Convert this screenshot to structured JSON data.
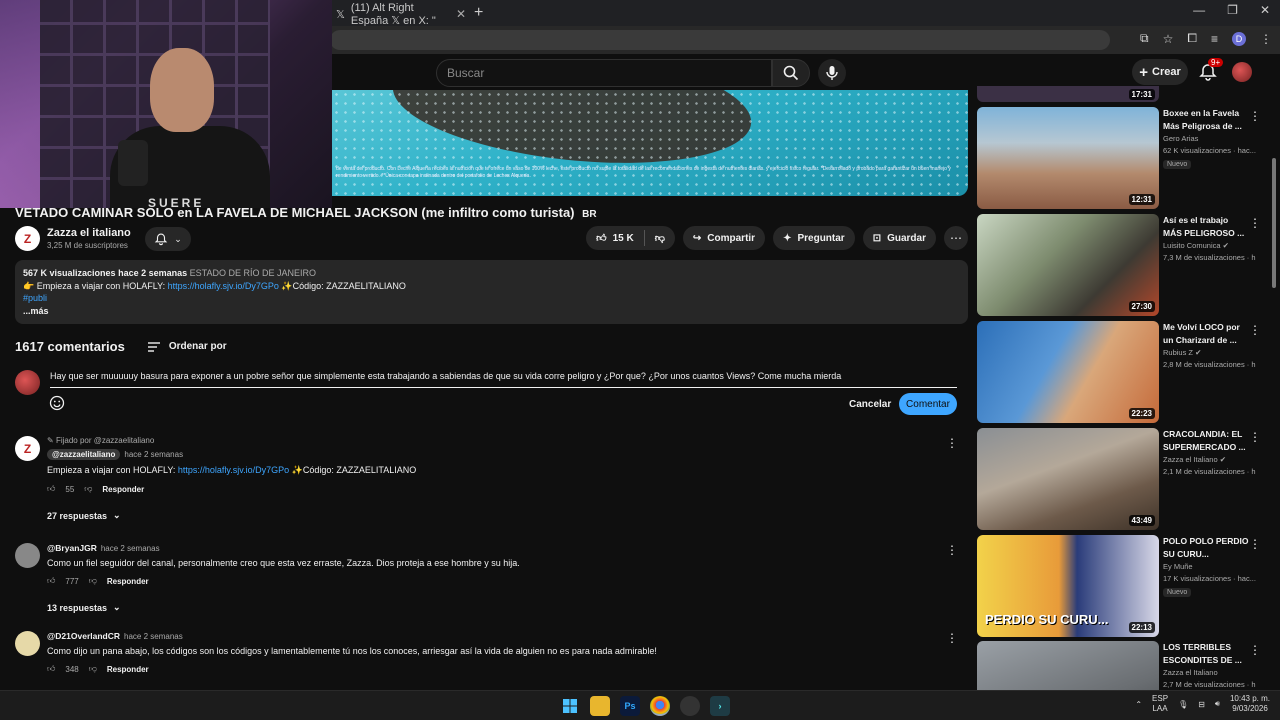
{
  "browser": {
    "tab_title": "(11) Alt Right España 𝕏 en X: \"(...",
    "tab_title_short": "(11) Alt Right España 𝕏 en X: \"",
    "profile_letter": "D"
  },
  "header": {
    "search_placeholder": "Buscar",
    "create_label": "Crear",
    "notifications_badge": "9+"
  },
  "video": {
    "disclaimer": "de venta del producto. Con Leche Alquería recibes la nutrición que te ofrece un vaso de 100% leche, este producto no suple la totalidad de las recomendaciones de ingesta de nutrientes diarias. y ejercicio físico regular. *Desarrollado y probado para garantizar un buen manejo y rendimiento vertido. **Única con tapa inclinada dentro del portafolio de Leches Alquería.",
    "title": "VETADO CAMINAR SOLO en LA FAVELA DE MICHAEL JACKSON (me infiltro como turista)",
    "title_flag": "BR",
    "channel_name": "Zazza el italiano",
    "subscribers": "3,25 M de suscriptores",
    "likes": "15 K",
    "share_label": "Compartir",
    "ask_label": "Preguntar",
    "save_label": "Guardar"
  },
  "description": {
    "views": "567 K visualizaciones",
    "date": "hace 2 semanas",
    "location": "ESTADO DE RÍO DE JANEIRO",
    "line2_prefix": "👉 Empieza a viajar con HOLAFLY:",
    "line2_link": "https://holafly.sjv.io/Dy7GPo",
    "line2_suffix": "✨Código: ZAZZAELITALIANO",
    "hashtag": "#publi",
    "more": "...más"
  },
  "comments": {
    "count_label": "1617 comentarios",
    "sort_label": "Ordenar por",
    "draft_text": "Hay que ser muuuuuy basura para exponer a un pobre señor que simplemente esta trabajando a sabiendas de que su vida corre peligro y ¿Por que? ¿Por unos cuantos Views? Come mucha mierda",
    "cancel_label": "Cancelar",
    "submit_label": "Comentar",
    "items": [
      {
        "pinned": "Fijado por @zazzaelitaliano",
        "author": "@zazzaelitaliano",
        "time": "hace 2 semanas",
        "text_prefix": "Empieza a viajar con HOLAFLY:",
        "text_link": "https://holafly.sjv.io/Dy7GPo",
        "text_suffix": "✨Código: ZAZZAELITALIANO",
        "likes": "55",
        "reply": "Responder",
        "replies": "27 respuestas"
      },
      {
        "author": "@BryanJGR",
        "time": "hace 2 semanas",
        "text": "Como un fiel seguidor del canal, personalmente creo que esta vez erraste, Zazza. Dios proteja a ese hombre y su hija.",
        "likes": "777",
        "reply": "Responder",
        "replies": "13 respuestas"
      },
      {
        "author": "@D21OverlandCR",
        "time": "hace 2 semanas",
        "text": "Como dijo un pana abajo, los códigos son los códigos y lamentablemente tú nos los conoces, arriesgar así la vida de alguien no es para nada admirable!",
        "likes": "348",
        "reply": "Responder"
      }
    ]
  },
  "sidebar": {
    "top_duration": "17:31",
    "items": [
      {
        "title": "Boxee en la Favela Más Peligrosa de ...",
        "channel": "Gero Arias",
        "views": "62 K visualizaciones · hac...",
        "badge": "Nuevo",
        "duration": "12:31"
      },
      {
        "title": "Así es el trabajo MÁS PELIGROSO ...",
        "channel": "Luisito Comunica",
        "views": "7,3 M de visualizaciones · h",
        "duration": "27:30"
      },
      {
        "title": "Me Volví LOCO por un Charizard de ...",
        "channel": "Rubius Z",
        "views": "2,8 M de visualizaciones · h",
        "duration": "22:23"
      },
      {
        "title": "CRACOLANDIA: EL SUPERMERCADO ...",
        "channel": "Zazza el Italiano",
        "views": "2,1 M de visualizaciones · h",
        "duration": "43:49"
      },
      {
        "title": "POLO POLO PERDIO SU CURU...",
        "channel": "Ey Muñe",
        "views": "17 K visualizaciones · hac...",
        "badge": "Nuevo",
        "duration": "22:13",
        "thumb_text": "PERDIO SU CURU..."
      },
      {
        "title": "LOS TERRIBLES ESCONDITES DE ...",
        "channel": "Zazza el Italiano",
        "views": "2,7 M de visualizaciones · h"
      }
    ]
  },
  "taskbar": {
    "lang_top": "ESP",
    "lang_bottom": "LAA",
    "time": "10:43 p. m.",
    "date": "9/03/2026"
  },
  "webcam": {
    "shirt_text": "SUERE"
  }
}
